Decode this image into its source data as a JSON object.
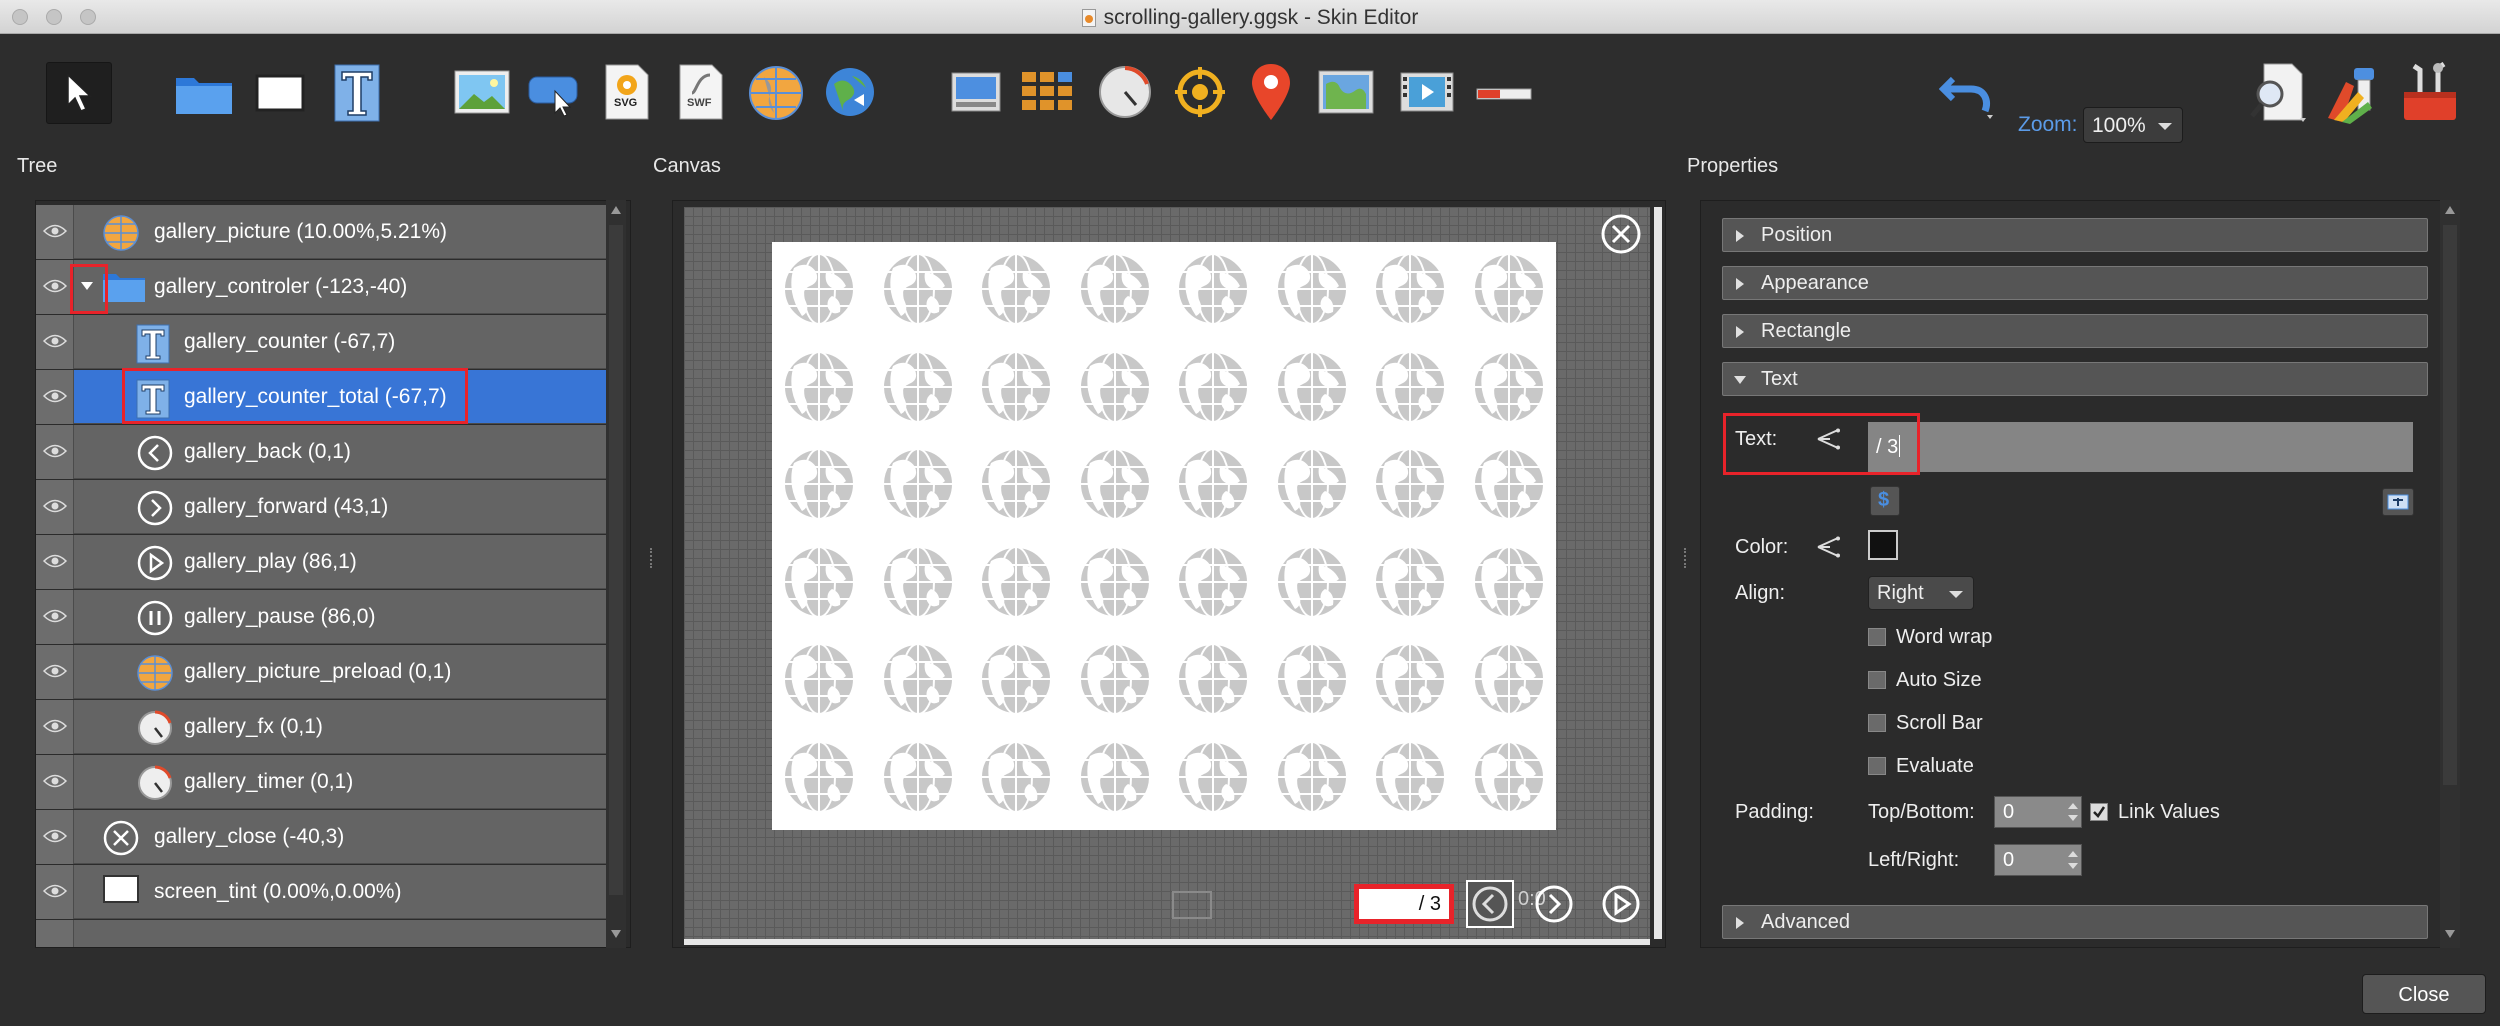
{
  "window": {
    "title": "scrolling-gallery.ggsk - Skin Editor"
  },
  "toolbar": {
    "zoom_label": "Zoom:",
    "zoom_value": "100%",
    "tools": [
      "pointer-icon",
      "folder-icon",
      "rectangle-icon",
      "text-icon",
      "image-icon",
      "button-icon",
      "svg-icon",
      "swf-icon",
      "panorama-icon",
      "map-icon",
      "video-icon",
      "cloner-icon",
      "dial-icon",
      "hotspot-icon",
      "map-pin-icon",
      "map-image-icon",
      "video-player-icon",
      "progress-bar-icon",
      "undo-icon",
      "search-doc-icon",
      "palette-icon",
      "toolbox-icon"
    ],
    "svg_text": "SVG",
    "swf_text": "SWF"
  },
  "panels": {
    "tree_title": "Tree",
    "canvas_title": "Canvas",
    "properties_title": "Properties"
  },
  "tree": {
    "rows": [
      {
        "label": "gallery_picture (10.00%,5.21%)",
        "icon": "picture-icon"
      },
      {
        "label": "gallery_controler (-123,-40)",
        "icon": "folder-icon"
      },
      {
        "label": "gallery_counter (-67,7)",
        "icon": "text-icon"
      },
      {
        "label": "gallery_counter_total (-67,7)",
        "icon": "text-icon"
      },
      {
        "label": "gallery_back (0,1)",
        "icon": "chevron-left-icon"
      },
      {
        "label": "gallery_forward (43,1)",
        "icon": "chevron-right-icon"
      },
      {
        "label": "gallery_play (86,1)",
        "icon": "play-icon"
      },
      {
        "label": "gallery_pause (86,0)",
        "icon": "pause-icon"
      },
      {
        "label": "gallery_picture_preload (0,1)",
        "icon": "picture-icon"
      },
      {
        "label": "gallery_fx (0,1)",
        "icon": "timer-icon"
      },
      {
        "label": "gallery_timer (0,1)",
        "icon": "timer-icon"
      },
      {
        "label": "gallery_close (-40,3)",
        "icon": "close-icon"
      },
      {
        "label": "screen_tint (0.00%,0.00%)",
        "icon": "rectangle-icon"
      }
    ],
    "selected_index": 3
  },
  "canvas": {
    "counter_text": "/ 3",
    "timer_text": "0:0"
  },
  "properties": {
    "sections": {
      "position": "Position",
      "appearance": "Appearance",
      "rectangle": "Rectangle",
      "text": "Text",
      "advanced": "Advanced"
    },
    "text_label": "Text:",
    "text_value": "/ 3",
    "color_label": "Color:",
    "color_value": "#000000",
    "align_label": "Align:",
    "align_value": "Right",
    "word_wrap": "Word wrap",
    "auto_size": "Auto Size",
    "scroll_bar": "Scroll Bar",
    "evaluate": "Evaluate",
    "padding_label": "Padding:",
    "top_bottom_label": "Top/Bottom:",
    "top_bottom_value": "0",
    "link_values": "Link Values",
    "left_right_label": "Left/Right:",
    "left_right_value": "0"
  },
  "footer": {
    "close_label": "Close"
  },
  "colors": {
    "selection": "#3875d6",
    "highlight": "#e8232a",
    "zoom_accent": "#5b9be8"
  }
}
